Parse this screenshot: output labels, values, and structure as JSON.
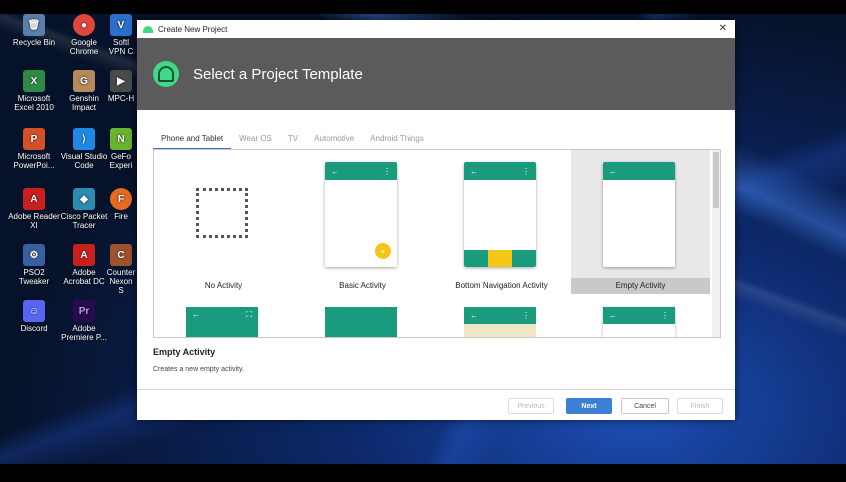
{
  "desktop": {
    "icons": [
      {
        "label": "Recycle Bin",
        "icon": "recycle-bin-icon",
        "color": "#5a7fa8"
      },
      {
        "label": "Google Chrome",
        "icon": "chrome-icon",
        "color": "#e0463a"
      },
      {
        "label": "Softl VPN C",
        "icon": "vpn-icon",
        "color": "#2a6fc9"
      },
      {
        "label": "Microsoft Excel 2010",
        "icon": "excel-icon",
        "color": "#2f8a45"
      },
      {
        "label": "Genshin Impact",
        "icon": "genshin-icon",
        "color": "#b48a5a"
      },
      {
        "label": "MPC-H",
        "icon": "mpc-icon",
        "color": "#4a4a4a"
      },
      {
        "label": "Microsoft PowerPoi...",
        "icon": "powerpoint-icon",
        "color": "#d3502b"
      },
      {
        "label": "Visual Studio Code",
        "icon": "vscode-icon",
        "color": "#1e88e5"
      },
      {
        "label": "GeFo Experi",
        "icon": "geforce-icon",
        "color": "#6ab32e"
      },
      {
        "label": "Adobe Reader XI",
        "icon": "adobe-reader-icon",
        "color": "#c8201d"
      },
      {
        "label": "Cisco Packet Tracer",
        "icon": "packet-tracer-icon",
        "color": "#2b8bb0"
      },
      {
        "label": "Fire",
        "icon": "firefox-icon",
        "color": "#e66a1f"
      },
      {
        "label": "PSO2 Tweaker",
        "icon": "pso2-icon",
        "color": "#3a5fa0"
      },
      {
        "label": "Adobe Acrobat DC",
        "icon": "acrobat-icon",
        "color": "#c8201d"
      },
      {
        "label": "Counter Nexon S",
        "icon": "counter-icon",
        "color": "#a0522d"
      },
      {
        "label": "Discord",
        "icon": "discord-icon",
        "color": "#5865f2"
      },
      {
        "label": "Adobe Premiere P...",
        "icon": "premiere-icon",
        "color": "#2a0b4d"
      }
    ]
  },
  "dialog": {
    "window_title": "Create New Project",
    "close_glyph": "✕",
    "heading": "Select a Project Template",
    "tabs": [
      {
        "label": "Phone and Tablet",
        "active": true
      },
      {
        "label": "Wear OS",
        "active": false
      },
      {
        "label": "TV",
        "active": false
      },
      {
        "label": "Automotive",
        "active": false
      },
      {
        "label": "Android Things",
        "active": false
      }
    ],
    "templates": [
      {
        "label": "No Activity"
      },
      {
        "label": "Basic Activity"
      },
      {
        "label": "Bottom Navigation Activity"
      },
      {
        "label": "Empty Activity",
        "selected": true
      }
    ],
    "description": {
      "title": "Empty Activity",
      "text": "Creates a new empty activity."
    },
    "buttons": {
      "previous": "Previous",
      "next": "Next",
      "cancel": "Cancel",
      "finish": "Finish"
    },
    "glyphs": {
      "back": "←",
      "menu": "⋮",
      "plus": "+",
      "fullscreen": "⛶"
    },
    "colors": {
      "banner": "#5b5b5b",
      "teal": "#1a9b7e",
      "accent": "#3e7fd6",
      "fab": "#f5c518"
    }
  }
}
